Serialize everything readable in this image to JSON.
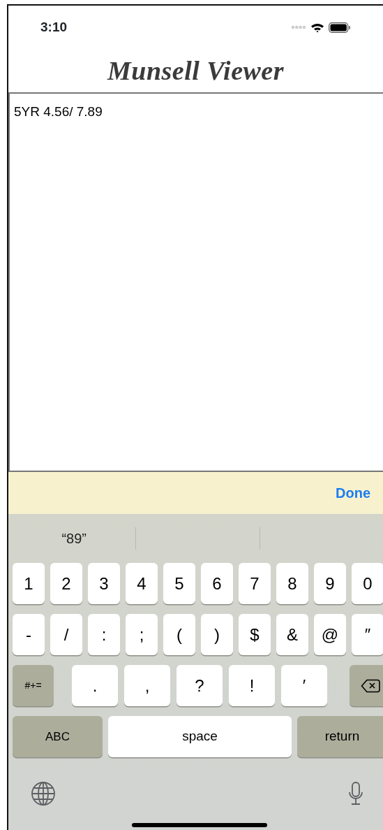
{
  "status_bar": {
    "time": "3:10"
  },
  "title": "Munsell Viewer",
  "text_area": {
    "value": "5YR 4.56/ 7.89"
  },
  "toolbar": {
    "done": "Done"
  },
  "suggestions": [
    "“89”"
  ],
  "keyboard": {
    "rows": [
      {
        "keys": [
          {
            "label": "1",
            "kind": "char"
          },
          {
            "label": "2",
            "kind": "char"
          },
          {
            "label": "3",
            "kind": "char"
          },
          {
            "label": "4",
            "kind": "char"
          },
          {
            "label": "5",
            "kind": "char"
          },
          {
            "label": "6",
            "kind": "char"
          },
          {
            "label": "7",
            "kind": "char"
          },
          {
            "label": "8",
            "kind": "char"
          },
          {
            "label": "9",
            "kind": "char"
          },
          {
            "label": "0",
            "kind": "char"
          }
        ]
      },
      {
        "keys": [
          {
            "label": "-",
            "kind": "char"
          },
          {
            "label": "/",
            "kind": "char"
          },
          {
            "label": ":",
            "kind": "char"
          },
          {
            "label": ";",
            "kind": "char"
          },
          {
            "label": "(",
            "kind": "char"
          },
          {
            "label": ")",
            "kind": "char"
          },
          {
            "label": "$",
            "kind": "char"
          },
          {
            "label": "&",
            "kind": "char"
          },
          {
            "label": "@",
            "kind": "char"
          },
          {
            "label": "″",
            "kind": "char"
          }
        ]
      },
      {
        "keys": [
          {
            "label": "#+=",
            "kind": "shift"
          },
          {
            "label": ".",
            "kind": "punct"
          },
          {
            "label": ",",
            "kind": "punct"
          },
          {
            "label": "?",
            "kind": "punct"
          },
          {
            "label": "!",
            "kind": "punct"
          },
          {
            "label": "′",
            "kind": "punct"
          },
          {
            "kind": "delete"
          }
        ]
      },
      {
        "keys": [
          {
            "label": "ABC",
            "kind": "mode"
          },
          {
            "label": "space",
            "kind": "space"
          },
          {
            "label": "return",
            "kind": "return"
          }
        ]
      }
    ]
  }
}
